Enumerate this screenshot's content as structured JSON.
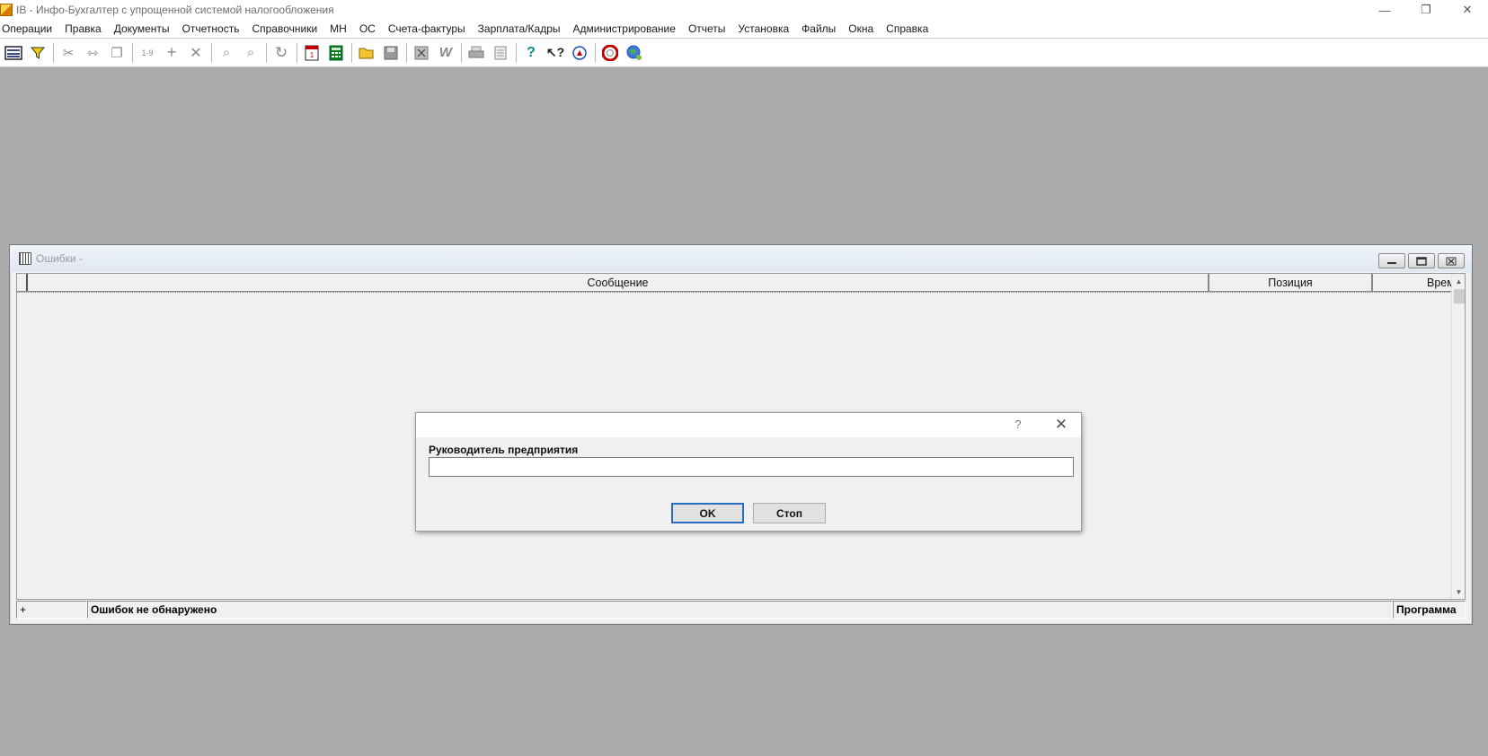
{
  "app": {
    "title": "IB - Инфо-Бухгалтер с упрощенной системой налогообложения",
    "icon": "app-logo-icon"
  },
  "window_controls": {
    "minimize": "—",
    "restore": "❐",
    "close": "✕"
  },
  "menu": [
    "Операции",
    "Правка",
    "Документы",
    "Отчетность",
    "Справочники",
    "МН",
    "ОС",
    "Счета-фактуры",
    "Зарплата/Кадры",
    "Администрирование",
    "Отчеты",
    "Установка",
    "Файлы",
    "Окна",
    "Справка"
  ],
  "toolbar": {
    "icons": [
      "keyboard-icon",
      "filter-icon",
      "cut-icon",
      "move-icon",
      "copy-icon",
      "sort-numbers-icon",
      "add-icon",
      "delete-icon",
      "search-icon",
      "search-replace-icon",
      "refresh-icon",
      "calendar-icon",
      "calculator-icon",
      "open-folder-icon",
      "save-icon",
      "excel-icon",
      "word-icon",
      "print-icon",
      "preview-icon",
      "help-icon",
      "context-help-icon",
      "navigator-icon",
      "support-icon",
      "web-icon"
    ]
  },
  "errors_window": {
    "title": "Ошибки -",
    "columns": [
      "Сообщение",
      "Позиция",
      "Время"
    ],
    "status": {
      "plus": "+",
      "message": "Ошибок не обнаружено",
      "source": "Программа"
    }
  },
  "dialog": {
    "help": "?",
    "close": "✕",
    "field_label": "Руководитель предприятия",
    "field_value": "",
    "ok_label": "OK",
    "stop_label": "Стоп"
  }
}
